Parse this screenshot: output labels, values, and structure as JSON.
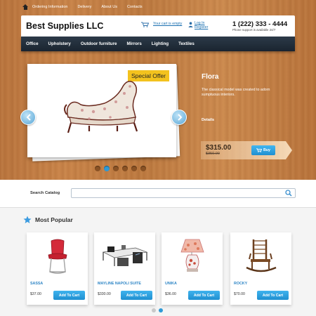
{
  "top_links": [
    "Ordering Information",
    "Delivery",
    "About Us",
    "Contacts"
  ],
  "header": {
    "logo": "Best Supplies LLC",
    "cart_text": "Your cart is empty",
    "login": "Log In",
    "register": "Register",
    "phone": "1 (222) 333 - 4444",
    "phone_sub": "Phone support is available 24/7"
  },
  "nav": [
    "Office",
    "Upholstery",
    "Outdoor furniture",
    "Mirrors",
    "Lighting",
    "Textiles"
  ],
  "slider": {
    "badge": "Special Offer",
    "product_name": "Flora",
    "description": "The classical model was created to adorn sumptuous interiors.",
    "details": "Details",
    "price": "$315.00",
    "old_price": "$350.00",
    "buy": "Buy",
    "slide_count": 6,
    "active_slide": 2
  },
  "search": {
    "label": "Search Catalog",
    "value": ""
  },
  "popular": {
    "title": "Most Popular",
    "add_label": "Add To Cart",
    "items": [
      {
        "name": "SASSA",
        "price": "$37.00",
        "icon": "red-chair"
      },
      {
        "name": "MAYLINE NAPOLI SUITE",
        "price": "$330.00",
        "icon": "office-desk"
      },
      {
        "name": "UNIKA",
        "price": "$36.00",
        "icon": "table-lamp"
      },
      {
        "name": "ROCKY",
        "price": "$70.00",
        "icon": "rocking-chair"
      }
    ],
    "page_count": 2,
    "active_page": 2
  },
  "colors": {
    "accent": "#2f9ad6",
    "badge": "#f3c21e",
    "nav_bg": "#1f2a36",
    "link": "#2f86c6"
  }
}
